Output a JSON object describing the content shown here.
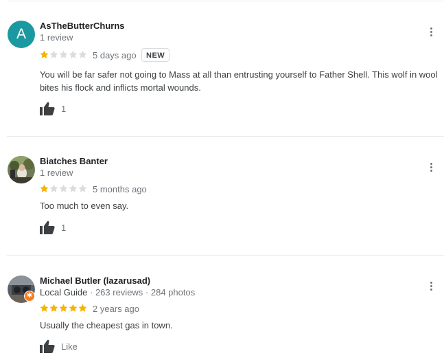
{
  "colors": {
    "star_filled": "#f4b400",
    "star_empty": "#dadce0",
    "avatar_teal": "#1a9aa0",
    "local_guide_badge": "#f37e21"
  },
  "reviews": [
    {
      "avatar_letter": "A",
      "author": "AsTheButterChurns",
      "meta": "1 review",
      "rating": 1,
      "date": "5 days ago",
      "badge": "NEW",
      "text": "You will be far safer not going to Mass at all than entrusting yourself to Father Shell. This wolf in wool bites his flock and inflicts mortal wounds.",
      "likes": "1"
    },
    {
      "author": "Biatches Banter",
      "meta": "1 review",
      "rating": 1,
      "date": "5 months ago",
      "text": "Too much to even say.",
      "likes": "1"
    },
    {
      "author": "Michael Butler (lazarusad)",
      "meta_guide": "Local Guide",
      "meta_rest": " · 263 reviews · 284 photos",
      "rating": 5,
      "date": "2 years ago",
      "text": "Usually the cheapest gas in town.",
      "likes": "Like"
    }
  ]
}
